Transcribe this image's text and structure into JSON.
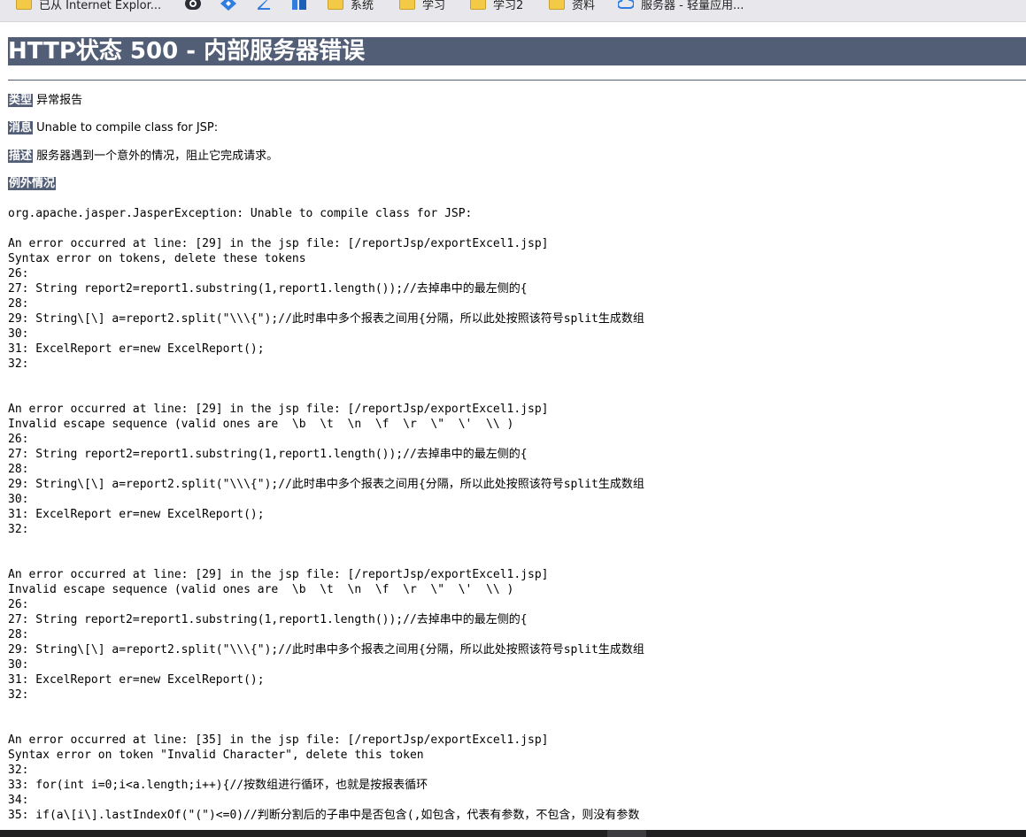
{
  "bookmarks": [
    {
      "icon": "folder-icon",
      "label": "已从 Internet Explor..."
    },
    {
      "icon": "eye-app-icon",
      "label": ""
    },
    {
      "icon": "diamond-app-icon",
      "label": ""
    },
    {
      "icon": "z-app-icon",
      "label": ""
    },
    {
      "icon": "hz-app-icon",
      "label": ""
    },
    {
      "icon": "folder-icon",
      "label": "系统"
    },
    {
      "icon": "folder-icon",
      "label": "学习"
    },
    {
      "icon": "folder-icon",
      "label": "学习2"
    },
    {
      "icon": "folder-icon",
      "label": "资料"
    },
    {
      "icon": "cloud-icon",
      "label": "服务器 - 轻量应用..."
    }
  ],
  "page": {
    "title": "HTTP状态 500 - 内部服务器错误",
    "type_label": "类型",
    "type_value": "异常报告",
    "message_label": "消息",
    "message_value": "Unable to compile class for JSP:",
    "description_label": "描述",
    "description_value": "服务器遇到一个意外的情况，阻止它完成请求。",
    "exception_label": "例外情况",
    "exception_first": "org.apache.jasper.JasperException: Unable to compile class for JSP:",
    "errors": [
      {
        "header": "An error occurred at line: [29] in the jsp file: [/reportJsp/exportExcel1.jsp]",
        "message": "Syntax error on tokens, delete these tokens",
        "lines": [
          "26:",
          "27: String report2=report1.substring(1,report1.length());//去掉串中的最左侧的{",
          "28:",
          "29: String\\[\\] a=report2.split(\"\\\\\\{\");//此时串中多个报表之间用{分隔，所以此处按照该符号split生成数组",
          "30:",
          "31: ExcelReport er=new ExcelReport();",
          "32:"
        ]
      },
      {
        "header": "An error occurred at line: [29] in the jsp file: [/reportJsp/exportExcel1.jsp]",
        "message": "Invalid escape sequence (valid ones are  \\b  \\t  \\n  \\f  \\r  \\\"  \\'  \\\\ )",
        "lines": [
          "26:",
          "27: String report2=report1.substring(1,report1.length());//去掉串中的最左侧的{",
          "28:",
          "29: String\\[\\] a=report2.split(\"\\\\\\{\");//此时串中多个报表之间用{分隔，所以此处按照该符号split生成数组",
          "30:",
          "31: ExcelReport er=new ExcelReport();",
          "32:"
        ]
      },
      {
        "header": "An error occurred at line: [29] in the jsp file: [/reportJsp/exportExcel1.jsp]",
        "message": "Invalid escape sequence (valid ones are  \\b  \\t  \\n  \\f  \\r  \\\"  \\'  \\\\ )",
        "lines": [
          "26:",
          "27: String report2=report1.substring(1,report1.length());//去掉串中的最左侧的{",
          "28:",
          "29: String\\[\\] a=report2.split(\"\\\\\\{\");//此时串中多个报表之间用{分隔，所以此处按照该符号split生成数组",
          "30:",
          "31: ExcelReport er=new ExcelReport();",
          "32:"
        ]
      },
      {
        "header": "An error occurred at line: [35] in the jsp file: [/reportJsp/exportExcel1.jsp]",
        "message": "Syntax error on token \"Invalid Character\", delete this token",
        "lines": [
          "32:",
          "33: for(int i=0;i<a.length;i++){//按数组进行循环，也就是按报表循环",
          "34:",
          "35: if(a\\[i\\].lastIndexOf(\"(\")<=0)//判断分割后的子串中是否包含(,如包含，代表有参数，不包含，则没有参数"
        ]
      }
    ]
  }
}
